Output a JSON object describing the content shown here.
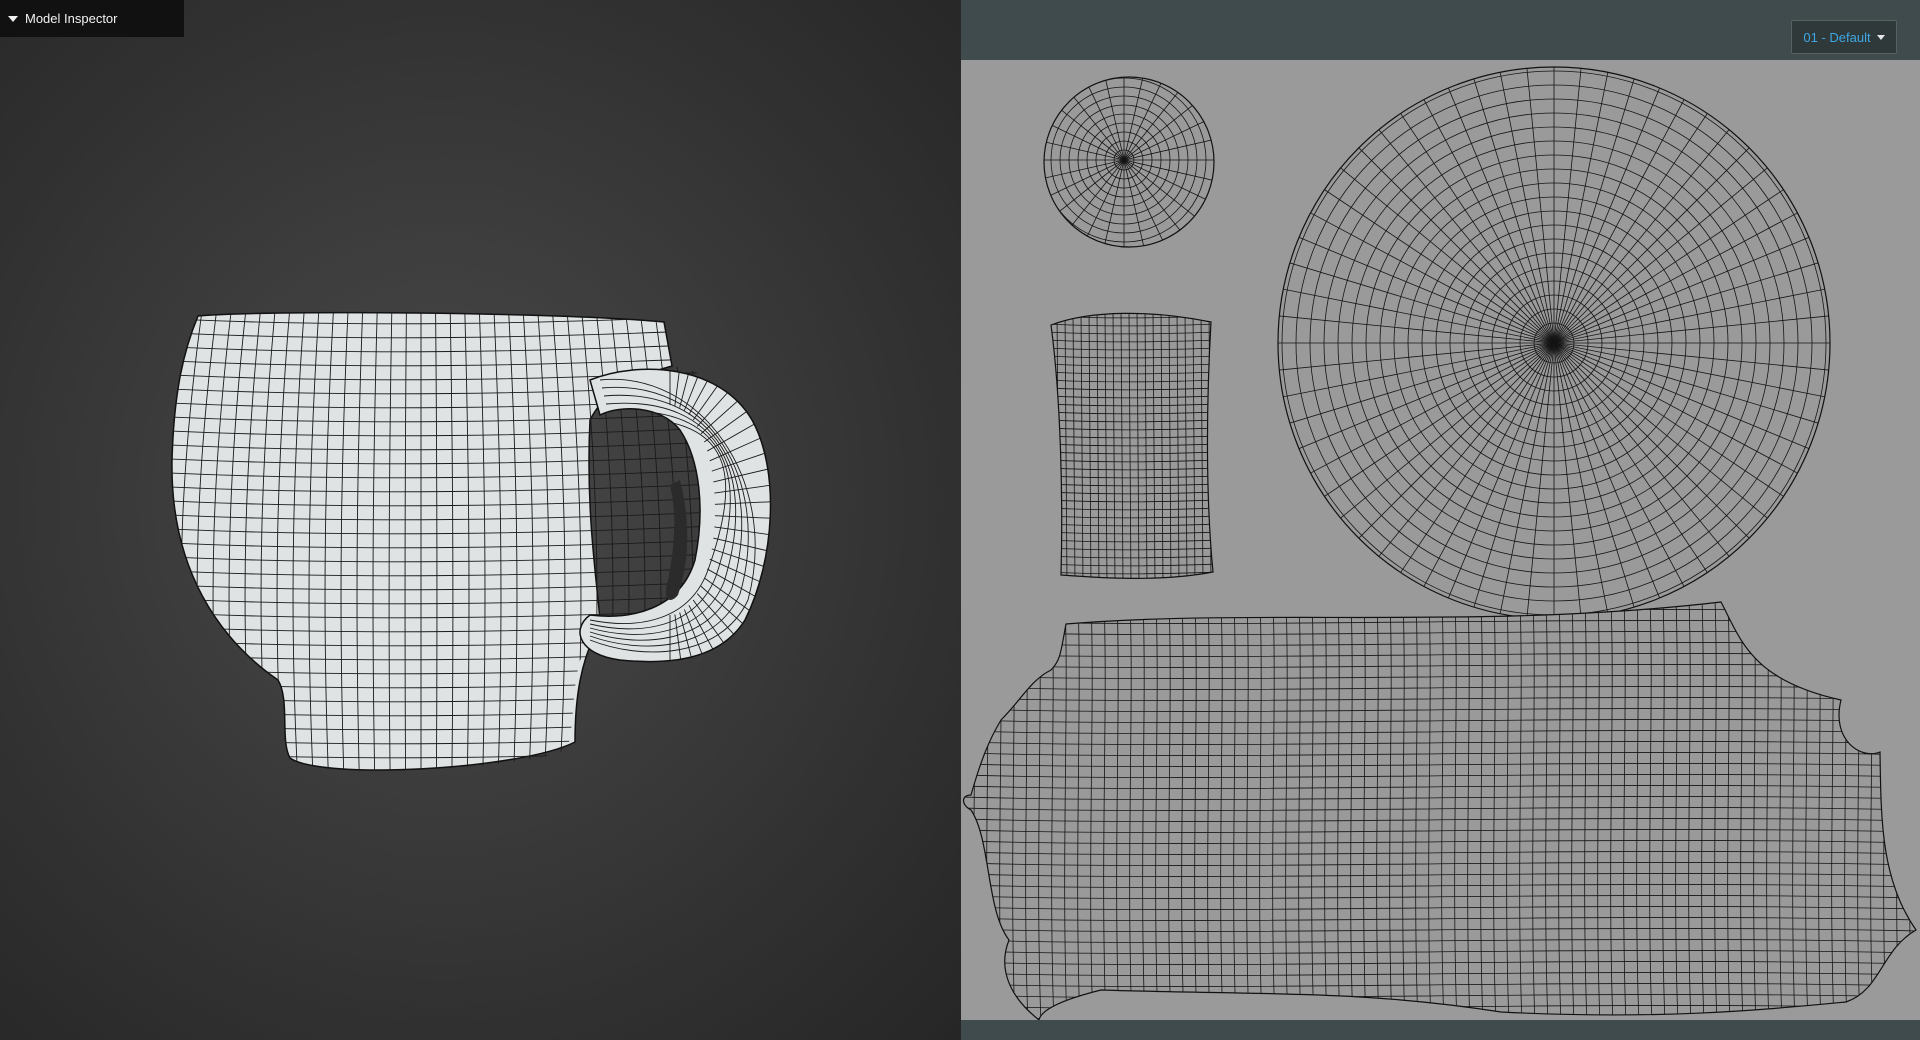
{
  "inspector": {
    "title": "Model Inspector",
    "collapse_icon": "caret-down-icon"
  },
  "uv_editor": {
    "material_label": "01 - Default",
    "dropdown_icon": "caret-down-icon"
  },
  "colors": {
    "viewport_bg": "#3d3d3d",
    "mesh_fill": "#dfe3e3",
    "wire": "#111111",
    "uv_bg": "#9a9a9a",
    "uv_frame": "#3f4b4c",
    "accent_text": "#3fa7e4"
  }
}
